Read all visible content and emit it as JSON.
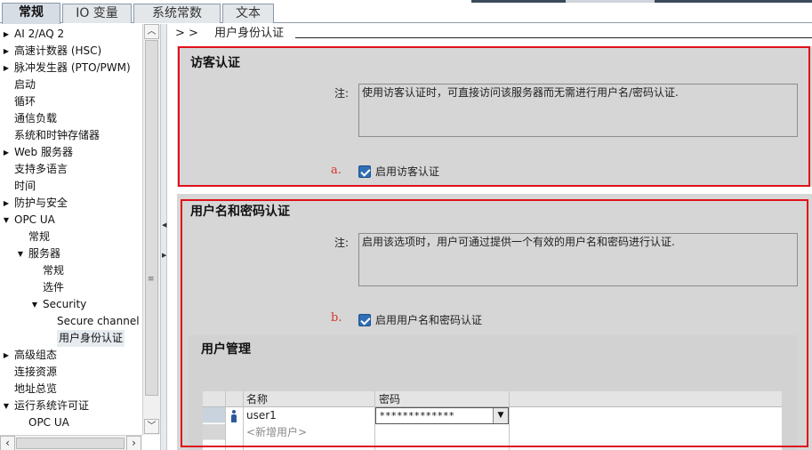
{
  "tabs": [
    {
      "label": "常规",
      "active": true
    },
    {
      "label": "IO 变量",
      "active": false
    },
    {
      "label": "系统常数",
      "active": false
    },
    {
      "label": "文本",
      "active": false
    }
  ],
  "tree": [
    {
      "label": "AI 2/AQ 2",
      "arrow": "right"
    },
    {
      "label": "高速计数器 (HSC)",
      "arrow": "right"
    },
    {
      "label": "脉冲发生器 (PTO/PWM)",
      "arrow": "right"
    },
    {
      "label": "启动",
      "arrow": ""
    },
    {
      "label": "循环",
      "arrow": ""
    },
    {
      "label": "通信负载",
      "arrow": ""
    },
    {
      "label": "系统和时钟存储器",
      "arrow": ""
    },
    {
      "label": "Web 服务器",
      "arrow": "right"
    },
    {
      "label": "支持多语言",
      "arrow": ""
    },
    {
      "label": "时间",
      "arrow": ""
    },
    {
      "label": "防护与安全",
      "arrow": "right"
    },
    {
      "label": "OPC UA",
      "arrow": "down"
    },
    {
      "label": "常规",
      "arrow": ""
    },
    {
      "label": "服务器",
      "arrow": "down"
    },
    {
      "label": "常规",
      "arrow": ""
    },
    {
      "label": "选件",
      "arrow": ""
    },
    {
      "label": "Security",
      "arrow": "down"
    },
    {
      "label": "Secure channel",
      "arrow": ""
    },
    {
      "label": "用户身份认证",
      "arrow": "",
      "selected": true
    },
    {
      "label": "高级组态",
      "arrow": "right"
    },
    {
      "label": "连接资源",
      "arrow": ""
    },
    {
      "label": "地址总览",
      "arrow": ""
    },
    {
      "label": "运行系统许可证",
      "arrow": "down"
    },
    {
      "label": "OPC UA",
      "arrow": ""
    }
  ],
  "breadcrumb": {
    "arrows": "> >",
    "title": "用户身份认证"
  },
  "guest": {
    "title": "访客认证",
    "note_label": "注:",
    "note_text": "使用访客认证时，可直接访问该服务器而无需进行用户名/密码认证.",
    "marker": "a.",
    "checkbox_label": "启用访客认证",
    "checked": true
  },
  "userpass": {
    "title": "用户名和密码认证",
    "note_label": "注:",
    "note_text": "启用该选项时，用户可通过提供一个有效的用户名和密码进行认证.",
    "marker": "b.",
    "checkbox_label": "启用用户名和密码认证",
    "checked": true
  },
  "user_mgmt": {
    "title": "用户管理",
    "columns": [
      "名称",
      "密码"
    ],
    "rows": [
      {
        "name": "user1",
        "password": "*************"
      }
    ],
    "add_placeholder": "<新增用户>"
  },
  "colors": {
    "annotation": "#e0101a",
    "checkbox": "#2f6fb5",
    "section_bg": "#d6d6d6",
    "marker": "#d8342a"
  },
  "icons": {
    "tree_collapsed": "triangle-right-icon",
    "tree_expanded": "triangle-down-icon",
    "user": "person-icon",
    "dropdown": "chevron-down-icon"
  }
}
